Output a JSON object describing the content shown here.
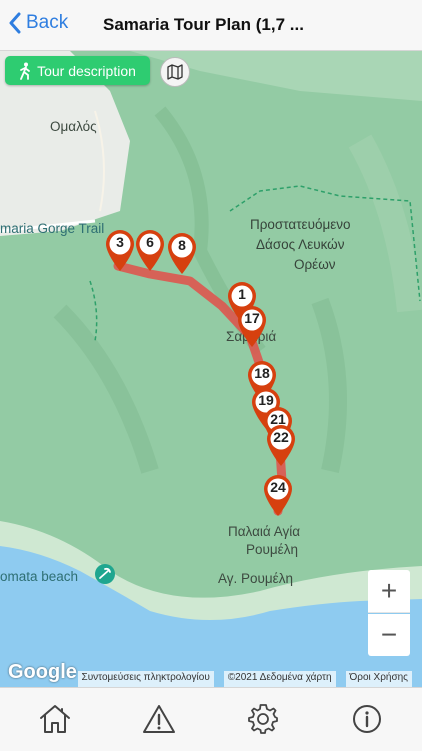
{
  "header": {
    "back_label": "Back",
    "title": "Samaria Tour Plan (1,7 ..."
  },
  "map": {
    "tour_button_label": "Tour description",
    "place_labels": {
      "omalos": "Ομαλός",
      "trail": "maria Gorge Trail",
      "protected_1": "Προστατευόμενο",
      "protected_2": "Δάσος Λευκών",
      "protected_3": "Ορέων",
      "samaria": "Σαμαριά",
      "agia_1": "Παλαιά Αγία",
      "agia_2": "Ρουμέλη",
      "ag_roumeli": "Αγ. Ρουμέλη",
      "beach": "omata beach"
    },
    "markers": [
      "3",
      "6",
      "8",
      "1",
      "17",
      "18",
      "19",
      "21",
      "22",
      "24"
    ],
    "zoom_in": "+",
    "zoom_out": "−",
    "google_logo": "Google",
    "attribution": {
      "shortcuts": "Συντομεύσεις πληκτρολογίου",
      "data": "©2021 Δεδομένα χάρτη",
      "terms": "Όροι Χρήσης"
    }
  },
  "tabbar": {
    "icons": [
      "home-icon",
      "warning-icon",
      "settings-gear-icon",
      "info-icon"
    ]
  },
  "colors": {
    "accent_blue": "#2f7ee0",
    "tour_green": "#2ecc71",
    "marker_red": "#d6400f",
    "route_red": "#e2504a",
    "sea_blue": "#8ecbf0"
  }
}
